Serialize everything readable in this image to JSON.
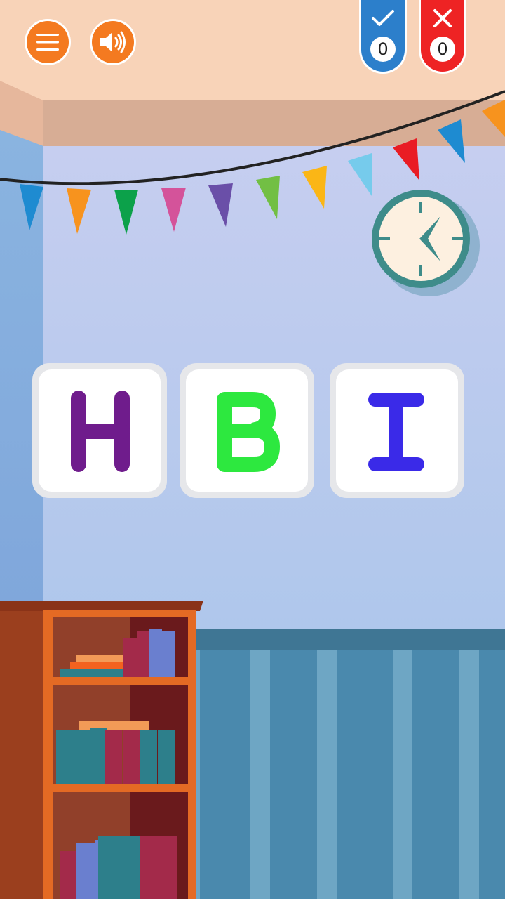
{
  "hud": {
    "menu_icon": "hamburger-menu-icon",
    "sound_icon": "speaker-volume-icon",
    "correct_icon": "check-icon",
    "wrong_icon": "x-icon",
    "correct_count": "0",
    "wrong_count": "0",
    "correct_color": "#2c7fcb",
    "wrong_color": "#ee2324",
    "button_color": "#f47a20"
  },
  "letters": [
    {
      "letter": "H",
      "color": "#6f1c8c"
    },
    {
      "letter": "B",
      "color": "#2de83f"
    },
    {
      "letter": "I",
      "color": "#3a2ae8"
    }
  ]
}
